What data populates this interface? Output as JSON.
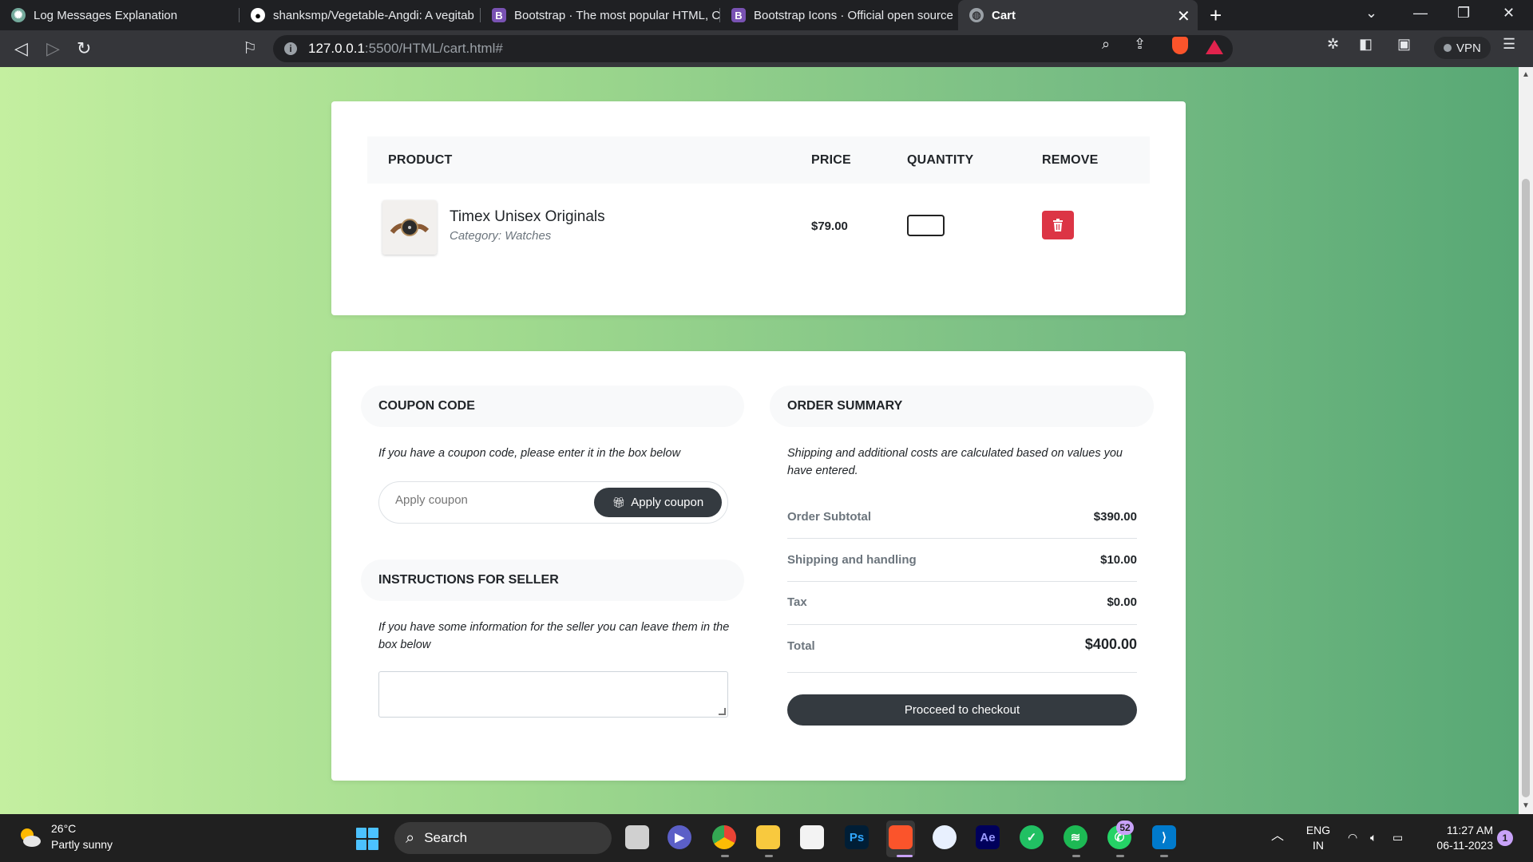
{
  "browser": {
    "tabs": [
      {
        "title": "Log Messages Explanation",
        "icon": "chatgpt-icon"
      },
      {
        "title": "shanksmp/Vegetable-Angdi: A vegitab",
        "icon": "github-icon"
      },
      {
        "title": "Bootstrap · The most popular HTML, C",
        "icon": "bootstrap-icon",
        "icon_text": "B"
      },
      {
        "title": "Bootstrap Icons · Official open source",
        "icon": "bootstrap-icon",
        "icon_text": "B"
      },
      {
        "title": "Cart",
        "icon": "globe-icon"
      }
    ],
    "url_host": "127.0.0.1",
    "url_path": ":5500/HTML/cart.html#",
    "vpn_label": "VPN"
  },
  "cart": {
    "headers": {
      "product": "Product",
      "price": "Price",
      "quantity": "Quantity",
      "remove": "Remove"
    },
    "items": [
      {
        "name": "Timex Unisex Originals",
        "category": "Category: Watches",
        "price": "$79.00",
        "quantity": ""
      }
    ]
  },
  "coupon": {
    "title": "Coupon code",
    "note": "If you have a coupon code, please enter it in the box below",
    "placeholder": "Apply coupon",
    "button_label": "Apply coupon"
  },
  "seller": {
    "title": "Instructions for seller",
    "note": "If you have some information for the seller you can leave them in the box below"
  },
  "summary": {
    "title": "Order summary",
    "note": "Shipping and additional costs are calculated based on values you have entered.",
    "rows": [
      {
        "label": "Order Subtotal",
        "value": "$390.00"
      },
      {
        "label": "Shipping and handling",
        "value": "$10.00"
      },
      {
        "label": "Tax",
        "value": "$0.00"
      },
      {
        "label": "Total",
        "value": "$400.00"
      }
    ],
    "checkout_label": "Procceed to checkout"
  },
  "taskbar": {
    "weather_temp": "26°C",
    "weather_desc": "Partly sunny",
    "search_label": "Search",
    "whatsapp_badge": "52",
    "lang_1": "ENG",
    "lang_2": "IN",
    "time": "11:27 AM",
    "date": "06-11-2023",
    "notif_count": "1",
    "ps_label": "Ps",
    "ae_label": "Ae"
  },
  "colors": {
    "remove_button": "#dc3545",
    "dark_button": "#343a40",
    "gradient_start": "#c4efa0",
    "gradient_end": "#58a875"
  }
}
